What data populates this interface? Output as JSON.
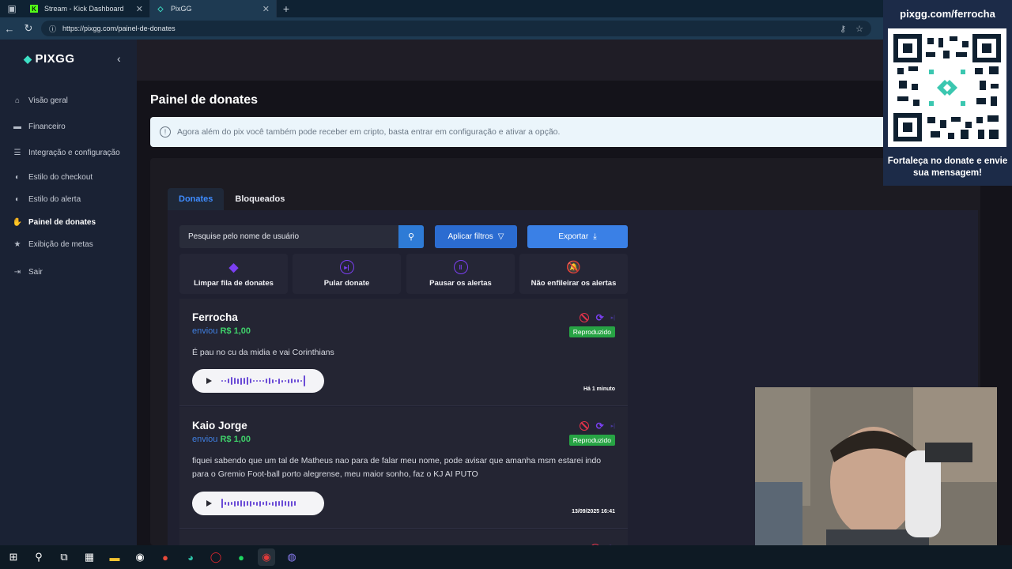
{
  "browser": {
    "tabs": [
      {
        "title": "Stream - Kick Dashboard",
        "active": false
      },
      {
        "title": "PixGG",
        "active": true
      }
    ],
    "url": "https://pixgg.com/painel-de-donates"
  },
  "sidebar": {
    "logo": "PIXGG",
    "items": [
      {
        "label": "Visão geral",
        "icon": "home-icon"
      },
      {
        "label": "Financeiro",
        "icon": "wallet-icon"
      },
      {
        "label": "Integração e configuração",
        "icon": "document-icon"
      },
      {
        "label": "Estilo do checkout",
        "icon": "palette-icon"
      },
      {
        "label": "Estilo do alerta",
        "icon": "palette-icon"
      },
      {
        "label": "Painel de donates",
        "icon": "hand-coin-icon",
        "active": true
      },
      {
        "label": "Exibição de metas",
        "icon": "star-icon"
      },
      {
        "label": "Sair",
        "icon": "logout-icon"
      }
    ]
  },
  "page": {
    "title": "Painel de donates",
    "info_banner": "Agora além do pix você também pode receber em cripto, basta entrar em configuração e ativar a opção."
  },
  "tabs": [
    {
      "label": "Donates",
      "active": true
    },
    {
      "label": "Bloqueados",
      "active": false
    }
  ],
  "toolbar": {
    "search_placeholder": "Pesquise pelo nome de usuário",
    "filter_label": "Aplicar filtros",
    "export_label": "Exportar"
  },
  "actions": [
    {
      "label": "Limpar fila de donates",
      "icon": "eraser-icon"
    },
    {
      "label": "Pular donate",
      "icon": "skip-icon"
    },
    {
      "label": "Pausar os alertas",
      "icon": "pause-icon"
    },
    {
      "label": "Não enfileirar os alertas",
      "icon": "bell-off-icon"
    }
  ],
  "donates": [
    {
      "name": "Ferrocha",
      "sent_label": "enviou",
      "amount": "R$ 1,00",
      "message": "É pau no cu da midia e vai Corinthians",
      "status": "Reproduzido",
      "time": "Há 1 minuto"
    },
    {
      "name": "Kaio Jorge",
      "sent_label": "enviou",
      "amount": "R$ 1,00",
      "message": "fiquei sabendo que um tal de Matheus nao para de falar meu nome, pode avisar que amanha msm estarei indo para o Gremio Foot-ball porto alegrense, meu maior sonho, faz o KJ AI PUTO",
      "status": "Reproduzido",
      "time": "13/09/2025 16:41"
    }
  ],
  "overlay": {
    "qr_url": "pixgg.com/ferrocha",
    "qr_caption": "Fortaleça no donate e envie sua mensagem!"
  },
  "colors": {
    "accent": "#3a80e6",
    "purple": "#7b3ff2",
    "success": "#27a444",
    "danger": "#e2334a",
    "amount": "#3fd06a"
  }
}
